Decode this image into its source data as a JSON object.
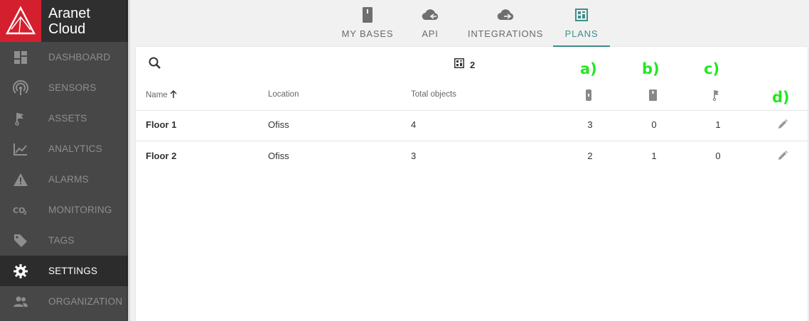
{
  "brand": {
    "line1": "Aranet",
    "line2": "Cloud"
  },
  "sidebar": {
    "items": [
      {
        "label": "DASHBOARD",
        "icon": "dashboard-icon",
        "active": false
      },
      {
        "label": "SENSORS",
        "icon": "sensors-icon",
        "active": false
      },
      {
        "label": "ASSETS",
        "icon": "assets-icon",
        "active": false
      },
      {
        "label": "ANALYTICS",
        "icon": "analytics-icon",
        "active": false
      },
      {
        "label": "ALARMS",
        "icon": "alarms-icon",
        "active": false
      },
      {
        "label": "MONITORING",
        "icon": "co2-icon",
        "active": false
      },
      {
        "label": "TAGS",
        "icon": "tag-icon",
        "active": false
      },
      {
        "label": "SETTINGS",
        "icon": "gear-icon",
        "active": true
      },
      {
        "label": "ORGANIZATION",
        "icon": "people-icon",
        "active": false
      }
    ]
  },
  "tabs": [
    {
      "label": "MY BASES",
      "icon": "base-station-icon",
      "active": false
    },
    {
      "label": "API",
      "icon": "cloud-api-icon",
      "active": false
    },
    {
      "label": "INTEGRATIONS",
      "icon": "cloud-integrations-icon",
      "active": false
    },
    {
      "label": "PLANS",
      "icon": "plans-icon",
      "active": true
    }
  ],
  "toolbar": {
    "count": "2"
  },
  "table": {
    "headers": {
      "name": "Name",
      "location": "Location",
      "total": "Total objects"
    },
    "rows": [
      {
        "name": "Floor 1",
        "location": "Ofiss",
        "total": "4",
        "sensors": "3",
        "bases": "0",
        "assets": "1"
      },
      {
        "name": "Floor 2",
        "location": "Ofiss",
        "total": "3",
        "sensors": "2",
        "bases": "1",
        "assets": "0"
      }
    ]
  },
  "annotations": {
    "a": "a)",
    "b": "b)",
    "c": "c)",
    "d": "d)"
  },
  "colors": {
    "accent": "#3f8f8a",
    "brand": "#d4202e",
    "annotation": "#22e822"
  }
}
